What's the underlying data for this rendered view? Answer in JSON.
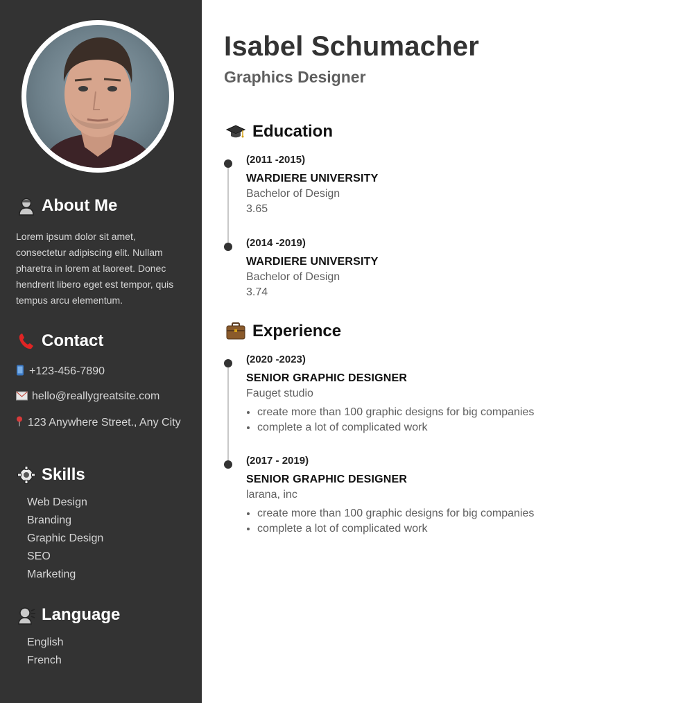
{
  "profile": {
    "name": "Isabel Schumacher",
    "role": "Graphics Designer"
  },
  "about": {
    "heading": "About Me",
    "icon": "person-icon",
    "text": "Lorem ipsum dolor sit amet, consectetur adipiscing elit. Nullam pharetra in lorem at laoreet. Donec hendrerit libero eget est tempor, quis tempus arcu elementum."
  },
  "contact": {
    "heading": "Contact",
    "icon": "phone-icon",
    "phone": "+123-456-7890",
    "email": "hello@reallygreatsite.com",
    "address": "123 Anywhere Street., Any City"
  },
  "skills": {
    "heading": "Skills",
    "icon": "gear-icon",
    "items": [
      "Web Design",
      "Branding",
      "Graphic Design",
      "SEO",
      "Marketing"
    ]
  },
  "language": {
    "heading": "Language",
    "icon": "speaking-head-icon",
    "items": [
      "English",
      "French"
    ]
  },
  "education": {
    "heading": "Education",
    "icon": "graduation-cap-icon",
    "entries": [
      {
        "period": "(2011 -2015)",
        "school": "WARDIERE UNIVERSITY",
        "degree": "Bachelor of Design",
        "gpa": "3.65"
      },
      {
        "period": "(2014 -2019)",
        "school": "WARDIERE UNIVERSITY",
        "degree": "Bachelor of Design",
        "gpa": "3.74"
      }
    ]
  },
  "experience": {
    "heading": "Experience",
    "icon": "briefcase-icon",
    "entries": [
      {
        "period": "(2020 -2023)",
        "title": "SENIOR GRAPHIC DESIGNER",
        "company": "Fauget studio",
        "bullets": [
          "create more than 100 graphic designs for big companies",
          "complete a lot of complicated work"
        ]
      },
      {
        "period": "(2017 - 2019)",
        "title": "SENIOR GRAPHIC DESIGNER",
        "company": "larana, inc",
        "bullets": [
          "create more than 100 graphic designs for big companies",
          "complete a lot of complicated work"
        ]
      }
    ]
  },
  "colors": {
    "sidebar": "#333333",
    "sidebar_text": "#d6d6d6",
    "heading_dark": "#333333",
    "muted": "#5f5f5f"
  }
}
